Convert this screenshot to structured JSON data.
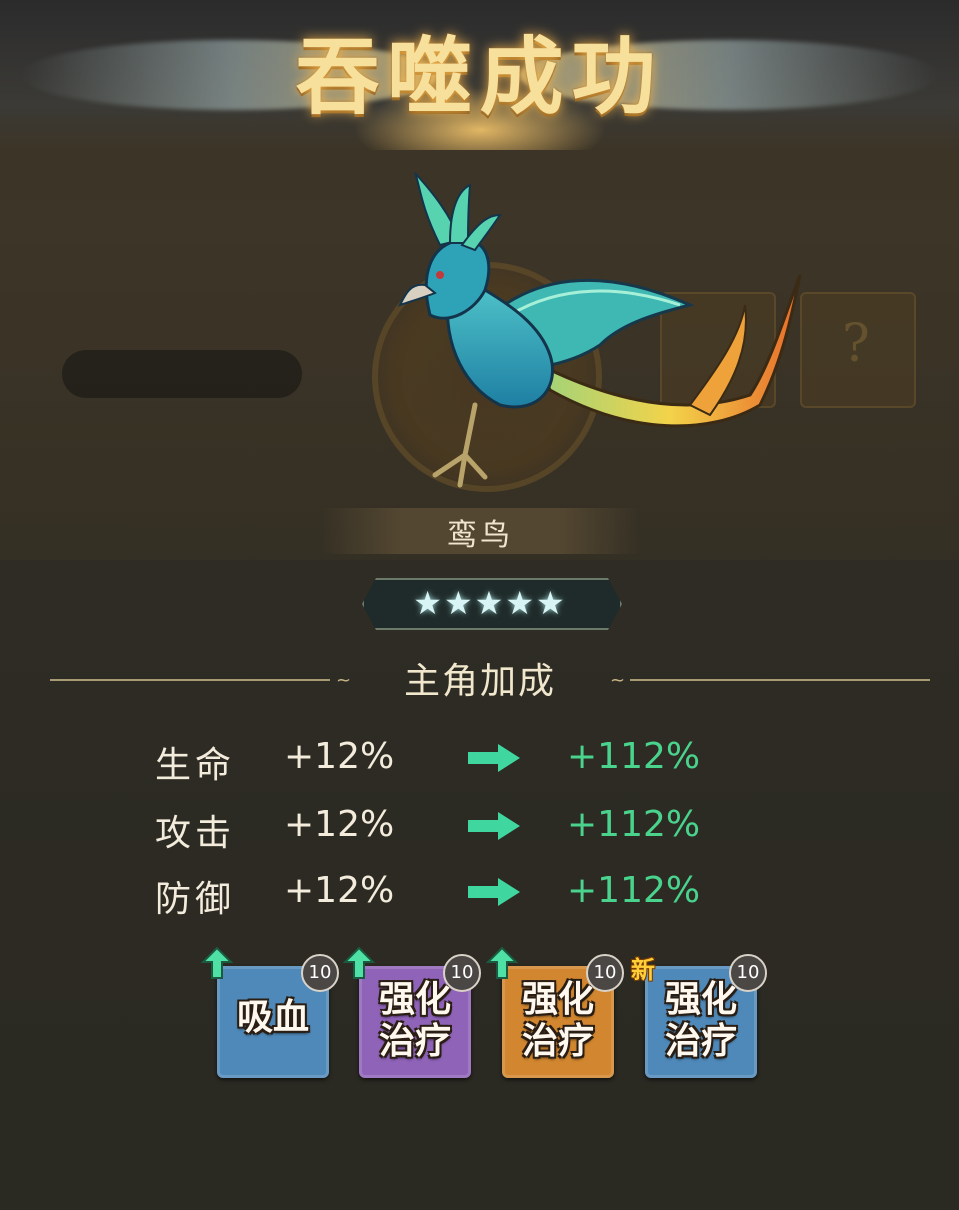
{
  "banner": {
    "title": "吞噬成功"
  },
  "beast": {
    "name": "鸾鸟",
    "stars": "★★★★★"
  },
  "section": {
    "title": "主角加成"
  },
  "stats": [
    {
      "label": "生命",
      "old": "+12%",
      "new": "+112%"
    },
    {
      "label": "攻击",
      "old": "+12%",
      "new": "+112%"
    },
    {
      "label": "防御",
      "old": "+12%",
      "new": "+112%"
    }
  ],
  "skills": [
    {
      "lines": [
        "吸血"
      ],
      "level": "10",
      "color": "#4f89b9",
      "badge": "up"
    },
    {
      "lines": [
        "强化",
        "治疗"
      ],
      "level": "10",
      "color": "#8f63b8",
      "badge": "up"
    },
    {
      "lines": [
        "强化",
        "治疗"
      ],
      "level": "10",
      "color": "#d1862f",
      "badge": "up"
    },
    {
      "lines": [
        "强化",
        "治疗"
      ],
      "level": "10",
      "color": "#4f89b9",
      "badge": "new",
      "badge_text": "新"
    }
  ],
  "colors": {
    "accent_green": "#49d38d",
    "arrow_green": "#3fd6a0"
  }
}
